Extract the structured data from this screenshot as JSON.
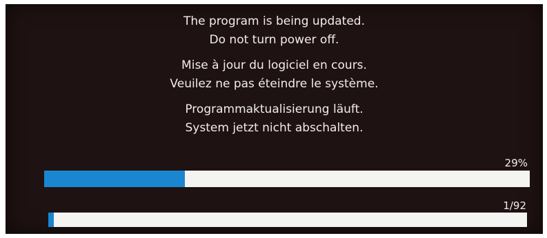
{
  "messages": {
    "english": [
      "The program is being updated.",
      "Do not turn power off."
    ],
    "french": [
      "Mise à jour du logiciel en cours.",
      "Veuilez ne pas éteindre le système."
    ],
    "german": [
      "Programmaktualisierung läuft.",
      "System jetzt nicht abschalten."
    ]
  },
  "progress": {
    "percent_label": "29%",
    "percent_value": 0.29,
    "count_label": "1/92",
    "count_value": 0.0109,
    "fill_color": "#1a86d0",
    "track_color": "#f4f4f2",
    "screen_color": "#1f1212"
  }
}
